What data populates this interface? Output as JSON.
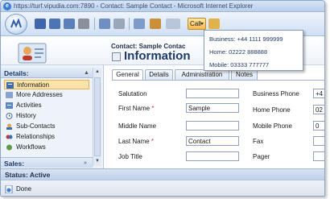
{
  "window": {
    "title": "https://turf.vipudia.com:7890 - Contact: Sample Contact - Microsoft Internet Explorer"
  },
  "toolbar": {
    "call_label": "Call"
  },
  "call_menu": {
    "items": [
      "Business: +44 1111 999999",
      "Home: 02222 888888",
      "Mobile: 03333 777777"
    ]
  },
  "record": {
    "type_label": "Contact: Sample Contac",
    "title": "Information"
  },
  "sidebar": {
    "section_label": "Details:",
    "items": [
      {
        "label": "Information",
        "icon": "information-icon",
        "active": true
      },
      {
        "label": "More Addresses",
        "icon": "addresses-icon"
      },
      {
        "label": "Activities",
        "icon": "activities-icon"
      },
      {
        "label": "History",
        "icon": "history-icon"
      },
      {
        "label": "Sub-Contacts",
        "icon": "sub-contacts-icon"
      },
      {
        "label": "Relationships",
        "icon": "relationships-icon"
      },
      {
        "label": "Workflows",
        "icon": "workflows-icon"
      }
    ],
    "sales_label": "Sales:"
  },
  "tabs": [
    {
      "label": "General",
      "active": true
    },
    {
      "label": "Details"
    },
    {
      "label": "Administration"
    },
    {
      "label": "Notes"
    }
  ],
  "form": {
    "left": [
      {
        "label": "Salutation",
        "value": "",
        "required": false
      },
      {
        "label": "First Name",
        "value": "Sample",
        "required": true
      },
      {
        "label": "Middle Name",
        "value": "",
        "required": false
      },
      {
        "label": "Last Name",
        "value": "Contact",
        "required": true
      },
      {
        "label": "Job Title",
        "value": "",
        "required": false
      }
    ],
    "right": [
      {
        "label": "Business Phone",
        "value": "+4"
      },
      {
        "label": "Home Phone",
        "value": "02"
      },
      {
        "label": "Mobile Phone",
        "value": "0"
      },
      {
        "label": "Fax",
        "value": ""
      },
      {
        "label": "Pager",
        "value": ""
      }
    ],
    "required_marker": "*"
  },
  "status": {
    "text": "Status: Active"
  },
  "browser_status": {
    "text": "Done"
  },
  "colors": {
    "accent": "#1f3a66",
    "active_item_bg": "#fde3a7",
    "call_button": "#f5b94b"
  }
}
